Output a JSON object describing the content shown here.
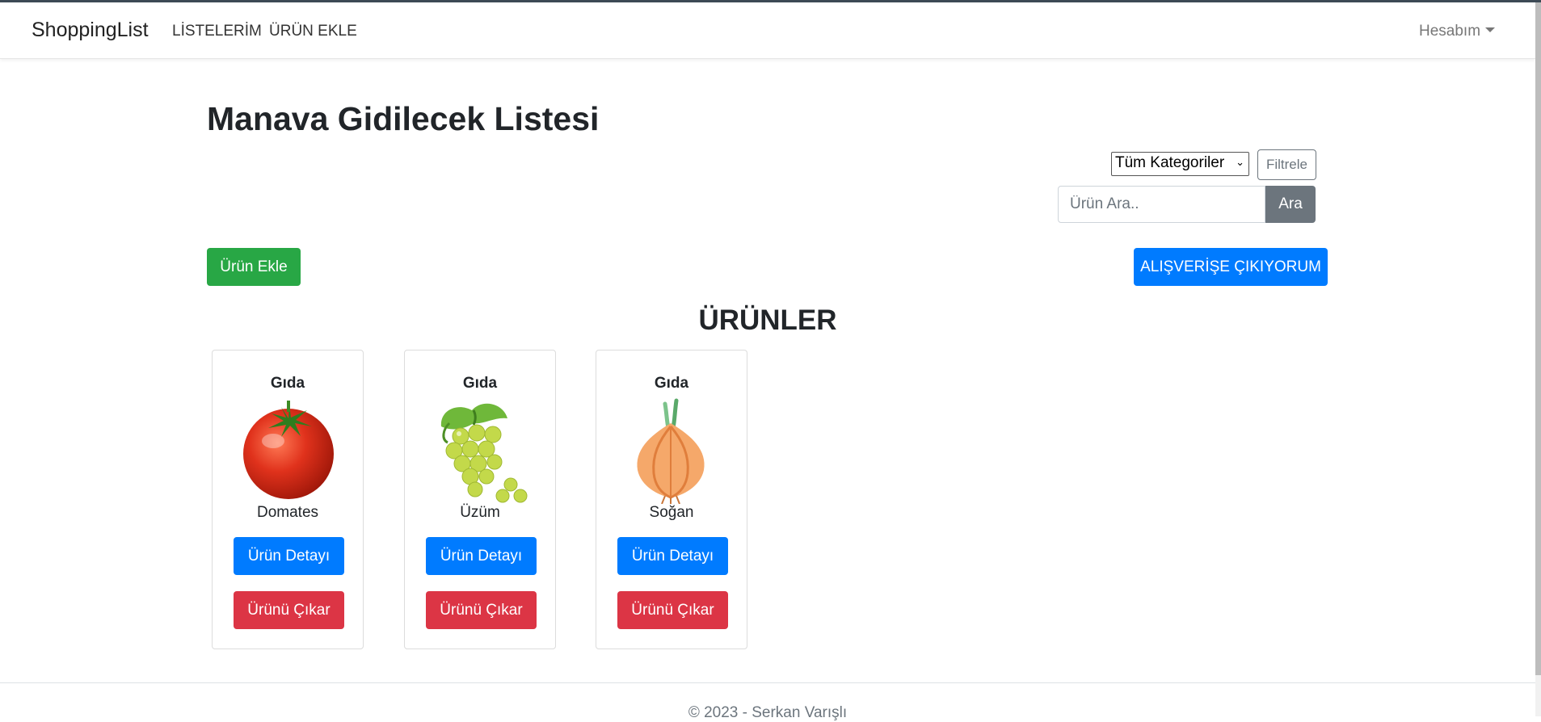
{
  "navbar": {
    "brand": "ShoppingList",
    "links": [
      "LİSTELERİM",
      "ÜRÜN EKLE"
    ],
    "account": "Hesabım"
  },
  "page": {
    "title": "Manava Gidilecek Listesi"
  },
  "filter": {
    "category_selected": "Tüm Kategoriler",
    "filter_label": "Filtrele",
    "search_placeholder": "Ürün Ara..",
    "search_label": "Ara"
  },
  "actions": {
    "add_product": "Ürün Ekle",
    "go_shopping": "ALIŞVERİŞE ÇIKIYORUM"
  },
  "section_title": "ÜRÜNLER",
  "products": [
    {
      "category": "Gıda",
      "name": "Domates",
      "image": "tomato",
      "detail_label": "Ürün Detayı",
      "remove_label": "Ürünü Çıkar"
    },
    {
      "category": "Gıda",
      "name": "Üzüm",
      "image": "grapes",
      "detail_label": "Ürün Detayı",
      "remove_label": "Ürünü Çıkar"
    },
    {
      "category": "Gıda",
      "name": "Soğan",
      "image": "onion",
      "detail_label": "Ürün Detayı",
      "remove_label": "Ürünü Çıkar"
    }
  ],
  "footer": {
    "text": "© 2023 - Serkan Varışlı"
  },
  "colors": {
    "success": "#28a745",
    "primary": "#007bff",
    "danger": "#dc3545",
    "secondary": "#6c757d"
  }
}
